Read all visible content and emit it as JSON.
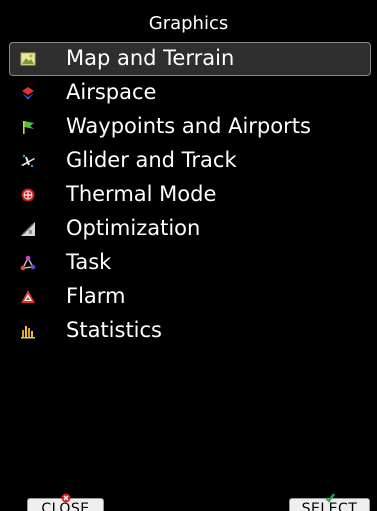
{
  "header": {
    "title": "Graphics"
  },
  "menu": {
    "items": [
      {
        "label": "Map and Terrain",
        "icon": "map-terrain-icon",
        "selected": true
      },
      {
        "label": "Airspace",
        "icon": "airspace-icon"
      },
      {
        "label": "Waypoints and Airports",
        "icon": "waypoint-flag-icon"
      },
      {
        "label": "Glider and Track",
        "icon": "glider-icon"
      },
      {
        "label": "Thermal Mode",
        "icon": "thermal-icon"
      },
      {
        "label": "Optimization",
        "icon": "optimization-icon"
      },
      {
        "label": "Task",
        "icon": "task-icon"
      },
      {
        "label": "Flarm",
        "icon": "flarm-icon"
      },
      {
        "label": "Statistics",
        "icon": "statistics-icon"
      }
    ]
  },
  "footer": {
    "close_label": "CLOSE",
    "select_label": "SELECT"
  },
  "colors": {
    "background": "#000000",
    "text": "#ffffff",
    "selection_border": "#8a8a8a",
    "button_face": "#efefef",
    "close_mark": "#e02020",
    "select_mark": "#22b04a"
  }
}
